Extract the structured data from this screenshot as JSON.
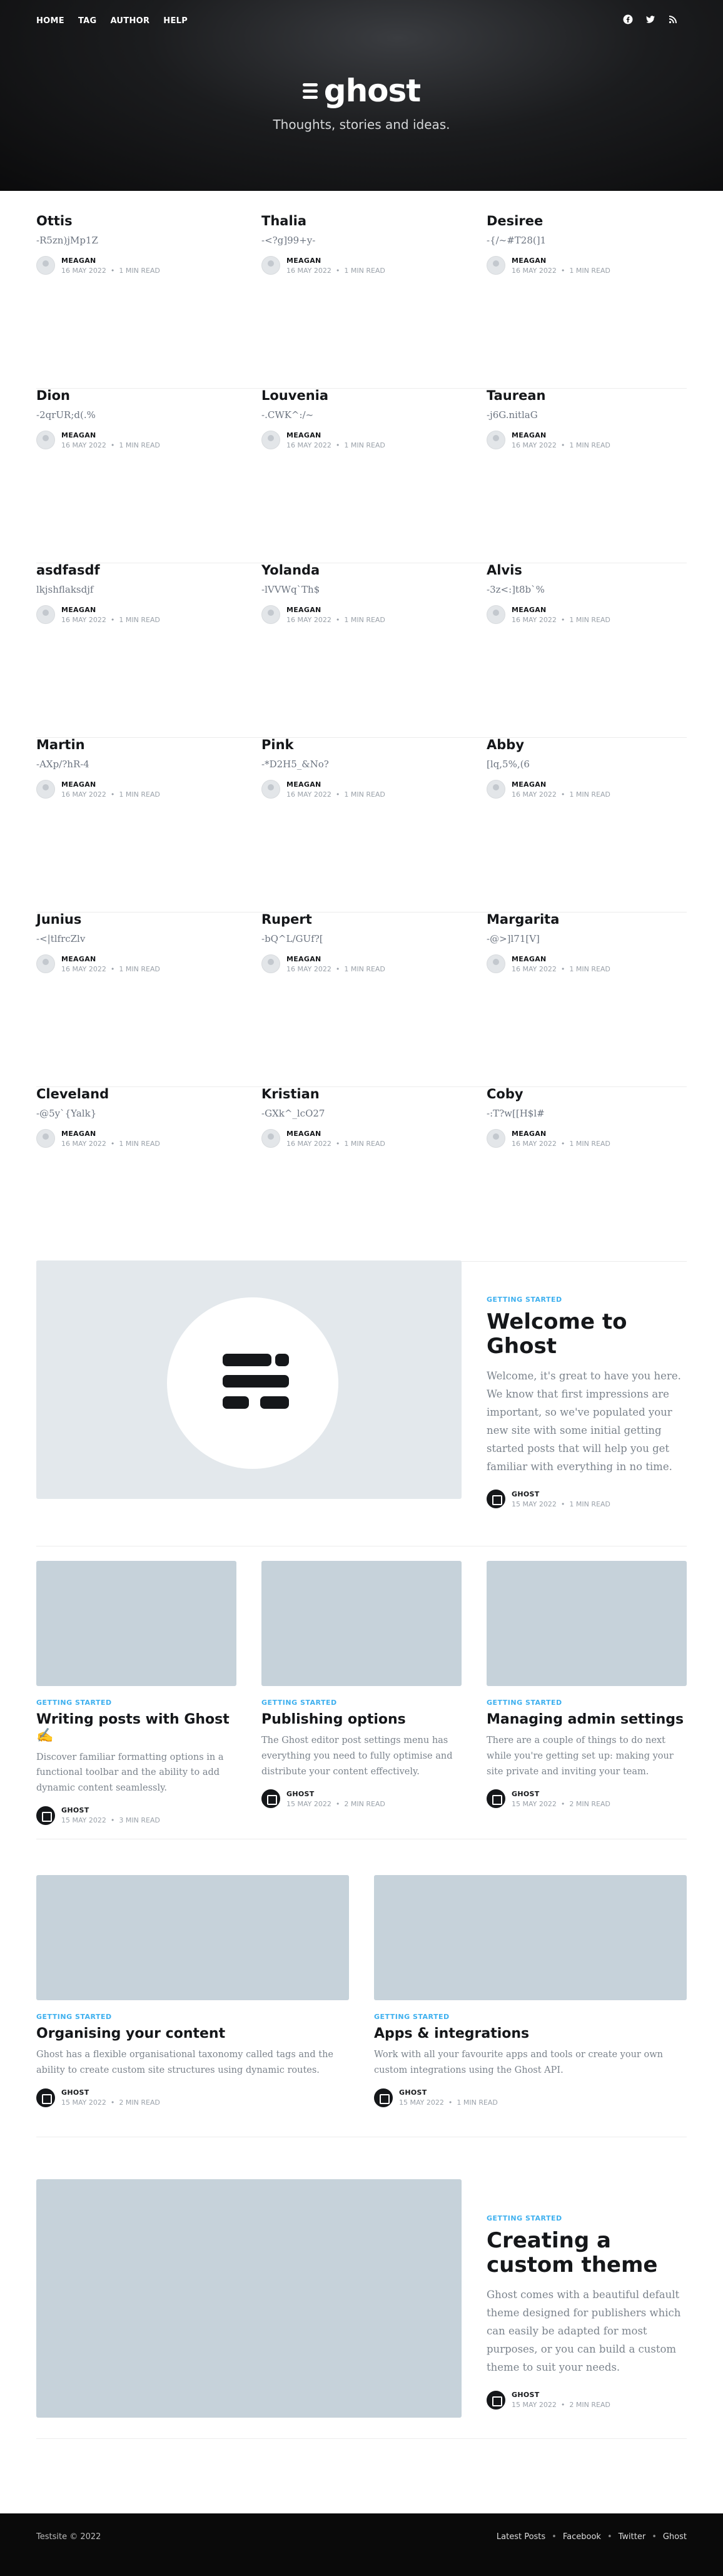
{
  "nav": [
    "HOME",
    "TAG",
    "AUTHOR",
    "HELP"
  ],
  "social": [
    "facebook-icon",
    "twitter-icon",
    "rss-icon"
  ],
  "logo": {
    "text": "ghost"
  },
  "tagline": "Thoughts, stories and ideas.",
  "author": "MEAGAN",
  "date": "16 MAY 2022",
  "read": "1 MIN READ",
  "rows": [
    [
      {
        "title": "Ottis",
        "excerpt": "-R5zn)jMp1Z"
      },
      {
        "title": "Thalia",
        "excerpt": "-<?g]99+y-"
      },
      {
        "title": "Desiree",
        "excerpt": "-{/~#T28(]1"
      }
    ],
    [
      {
        "title": "Dion",
        "excerpt": "-2qrUR;d(.%"
      },
      {
        "title": "Louvenia",
        "excerpt": "-.CWK^:/~"
      },
      {
        "title": "Taurean",
        "excerpt": "-j6G.nitlaG"
      }
    ],
    [
      {
        "title": "asdfasdf",
        "excerpt": "lkjshflaksdjf"
      },
      {
        "title": "Yolanda",
        "excerpt": "-lVVWq`Th$"
      },
      {
        "title": "Alvis",
        "excerpt": "-3z<:]t8b`%"
      }
    ],
    [
      {
        "title": "Martin",
        "excerpt": "-AXp/?hR-4"
      },
      {
        "title": "Pink",
        "excerpt": "-*D2H5_&No?"
      },
      {
        "title": "Abby",
        "excerpt": "[lq,5%,(6"
      }
    ],
    [
      {
        "title": "Junius",
        "excerpt": "-<|tlfrcZlv"
      },
      {
        "title": "Rupert",
        "excerpt": "-bQ^L/GUf?["
      },
      {
        "title": "Margarita",
        "excerpt": "-@>]l71[V]"
      }
    ],
    [
      {
        "title": "Cleveland",
        "excerpt": "-@5y`{Yalk}"
      },
      {
        "title": "Kristian",
        "excerpt": "-GXk^_lcO27"
      },
      {
        "title": "Coby",
        "excerpt": "-:T?w[[H$l#"
      }
    ]
  ],
  "featured": {
    "tag": "GETTING STARTED",
    "title": "Welcome to Ghost",
    "excerpt": "Welcome, it's great to have you here. We know that first impressions are important, so we've populated your new site with some initial getting started posts that will help you get familiar with everything in no time.",
    "author": "GHOST",
    "date": "15 MAY 2022",
    "read": "1 MIN READ"
  },
  "three": [
    {
      "tag": "GETTING STARTED",
      "title": "Writing posts with Ghost ✍️",
      "excerpt": "Discover familiar formatting options in a functional toolbar and the ability to add dynamic content seamlessly.",
      "author": "GHOST",
      "date": "15 MAY 2022",
      "read": "3 MIN READ"
    },
    {
      "tag": "GETTING STARTED",
      "title": "Publishing options",
      "excerpt": "The Ghost editor post settings menu has everything you need to fully optimise and distribute your content effectively.",
      "author": "GHOST",
      "date": "15 MAY 2022",
      "read": "2 MIN READ"
    },
    {
      "tag": "GETTING STARTED",
      "title": "Managing admin settings",
      "excerpt": "There are a couple of things to do next while you're getting set up: making your site private and inviting your team.",
      "author": "GHOST",
      "date": "15 MAY 2022",
      "read": "2 MIN READ"
    }
  ],
  "two": [
    {
      "tag": "GETTING STARTED",
      "title": "Organising your content",
      "excerpt": "Ghost has a flexible organisational taxonomy called tags and the ability to create custom site structures using dynamic routes.",
      "author": "GHOST",
      "date": "15 MAY 2022",
      "read": "2 MIN READ"
    },
    {
      "tag": "GETTING STARTED",
      "title": "Apps & integrations",
      "excerpt": "Work with all your favourite apps and tools or create your own custom integrations using the Ghost API.",
      "author": "GHOST",
      "date": "15 MAY 2022",
      "read": "1 MIN READ"
    }
  ],
  "last": {
    "tag": "GETTING STARTED",
    "title": "Creating a custom theme",
    "excerpt": "Ghost comes with a beautiful default theme designed for publishers which can easily be adapted for most purposes, or you can build a custom theme to suit your needs.",
    "author": "GHOST",
    "date": "15 MAY 2022",
    "read": "2 MIN READ"
  },
  "footer": {
    "copy": "Testsite © 2022",
    "links": [
      "Latest Posts",
      "Facebook",
      "Twitter",
      "Ghost"
    ]
  }
}
